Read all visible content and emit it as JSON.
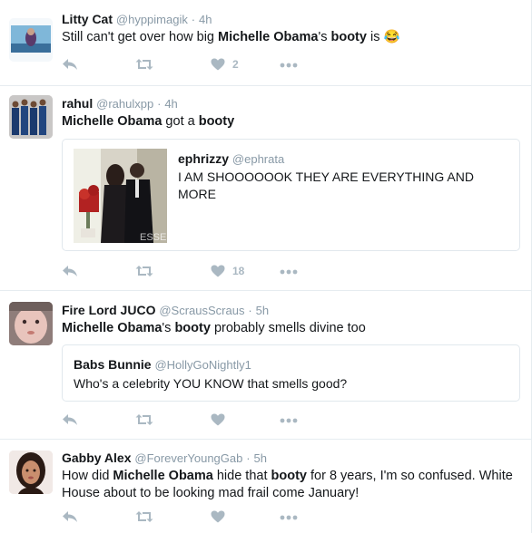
{
  "tweets": [
    {
      "name": "Litty Cat",
      "handle": "@hyppimagik",
      "dot": "·",
      "time": "4h",
      "text_parts": [
        "Still can't get over how big ",
        "Michelle Obama",
        "'s ",
        "booty",
        " is "
      ],
      "emoji": "😂",
      "likes": "2"
    },
    {
      "name": "rahul",
      "handle": "@rahulxpp",
      "dot": "·",
      "time": "4h",
      "text_parts": [
        "Michelle Obama",
        " got a ",
        "booty"
      ],
      "quote": {
        "name": "ephrizzy",
        "handle": "@ephrata",
        "text": "I AM SHOOOOOOK THEY ARE EVERYTHING AND MORE",
        "media_watermark": "ESSE"
      },
      "likes": "18"
    },
    {
      "name": "Fire Lord JUCO",
      "handle": "@ScrausScraus",
      "dot": "·",
      "time": "5h",
      "text_parts": [
        "Michelle Obama",
        "'s ",
        "booty",
        " probably smells divine too"
      ],
      "quote": {
        "name": "Babs Bunnie",
        "handle": "@HollyGoNightly1",
        "text": "Who's a celebrity YOU KNOW that smells good?"
      },
      "likes": ""
    },
    {
      "name": "Gabby Alex",
      "handle": "@ForeverYoungGab",
      "dot": "·",
      "time": "5h",
      "text_parts": [
        "How did ",
        "Michelle Obama",
        " hide that ",
        "booty",
        " for 8 years, I'm so confused. White House about to be looking mad frail come January!"
      ],
      "likes": ""
    }
  ],
  "colors": {
    "icon": "#aab8c2",
    "meta": "#8899a6",
    "border": "#e6ecf0"
  }
}
